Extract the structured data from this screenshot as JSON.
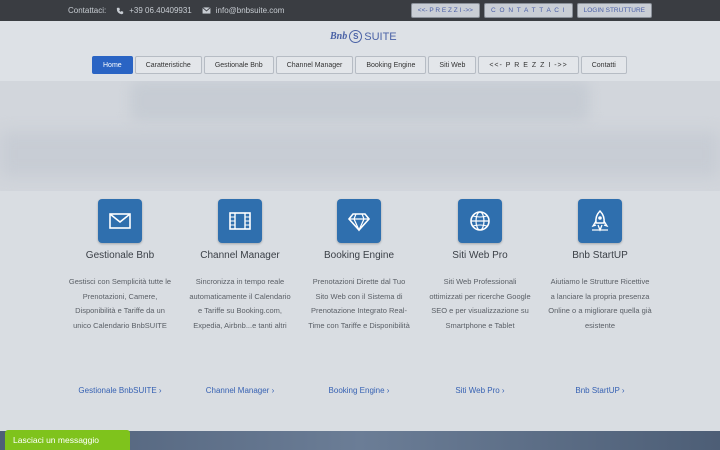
{
  "topbar": {
    "contact_label": "Contattaci:",
    "phone": "+39 06.40409931",
    "email": "info@bnbsuite.com",
    "buttons": [
      "<<- P R E Z Z I ->>",
      "C O N T A T T A C I",
      "LOGIN STRUTTURE"
    ]
  },
  "logo": {
    "part1": "Bnb",
    "mark": "S",
    "part2": "SUITE"
  },
  "nav": {
    "tabs": [
      "Home",
      "Caratteristiche",
      "Gestionale Bnb",
      "Channel Manager",
      "Booking Engine",
      "Siti Web",
      "<<- P R E Z Z I ->>",
      "Contatti"
    ],
    "active": "Home"
  },
  "features": [
    {
      "title": "Gestionale Bnb",
      "desc": "Gestisci con Semplicità tutte le Prenotazioni, Camere, Disponibilità e Tariffe da un unico Calendario BnbSUITE",
      "link": "Gestionale BnbSUITE ›",
      "icon": "envelope-icon"
    },
    {
      "title": "Channel Manager",
      "desc": "Sincronizza in tempo reale automaticamente il Calendario e Tariffe su Booking.com, Expedia, Airbnb...e tanti altri",
      "link": "Channel Manager ›",
      "icon": "film-icon"
    },
    {
      "title": "Booking Engine",
      "desc": "Prenotazioni Dirette dal Tuo Sito Web con il Sistema di Prenotazione Integrato Real-Time con Tariffe e Disponibilità",
      "link": "Booking Engine ›",
      "icon": "diamond-icon"
    },
    {
      "title": "Siti Web Pro",
      "desc": "Siti Web Professionali ottimizzati per ricerche Google SEO e per visualizzazione su Smartphone e Tablet",
      "link": "Siti Web Pro ›",
      "icon": "globe-icon"
    },
    {
      "title": "Bnb StartUP",
      "desc": "Aiutiamo le Strutture Ricettive a lanciare la propria presenza Online o a migliorare quella già esistente",
      "link": "Bnb StartUP ›",
      "icon": "rocket-icon"
    }
  ],
  "chat": {
    "label": "Lasciaci un messaggio"
  }
}
